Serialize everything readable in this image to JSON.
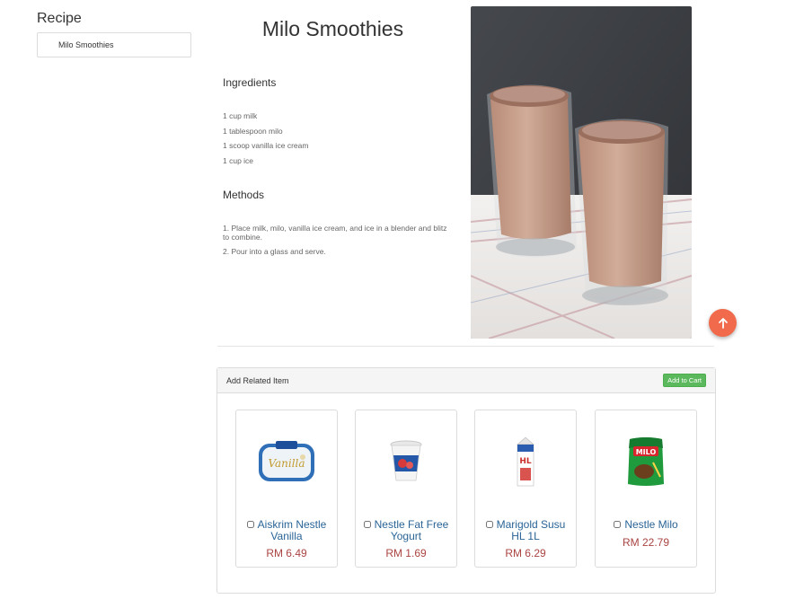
{
  "sidebar": {
    "title": "Recipe",
    "items": [
      {
        "label": "Milo Smoothies"
      }
    ]
  },
  "recipe": {
    "title": "Milo Smoothies",
    "ingredients_heading": "Ingredients",
    "ingredients": [
      "1 cup milk",
      "1 tablespoon milo",
      "1 scoop vanilla ice cream",
      "1 cup ice"
    ],
    "methods_heading": "Methods",
    "methods": [
      "1. Place milk, milo, vanilla ice cream, and ice in a blender and blitz to combine.",
      "2. Pour into a glass and serve."
    ]
  },
  "related": {
    "title": "Add Related Item",
    "cart_button": "Add to Cart",
    "items": [
      {
        "name": "Aiskrim Nestle Vanilla",
        "price": "RM 6.49",
        "icon": "ice-cream-tub-icon"
      },
      {
        "name": "Nestle Fat Free Yogurt",
        "price": "RM 1.69",
        "icon": "yogurt-cup-icon"
      },
      {
        "name": "Marigold Susu HL 1L",
        "price": "RM 6.29",
        "icon": "milk-carton-icon"
      },
      {
        "name": "Nestle Milo",
        "price": "RM 22.79",
        "icon": "milo-pack-icon"
      }
    ]
  },
  "colors": {
    "accent": "#f06a4b",
    "cart_button": "#5cb85c",
    "price": "#a94442",
    "product_name": "#2a6496"
  },
  "icons": {
    "scroll_top": "arrow-up-icon"
  }
}
